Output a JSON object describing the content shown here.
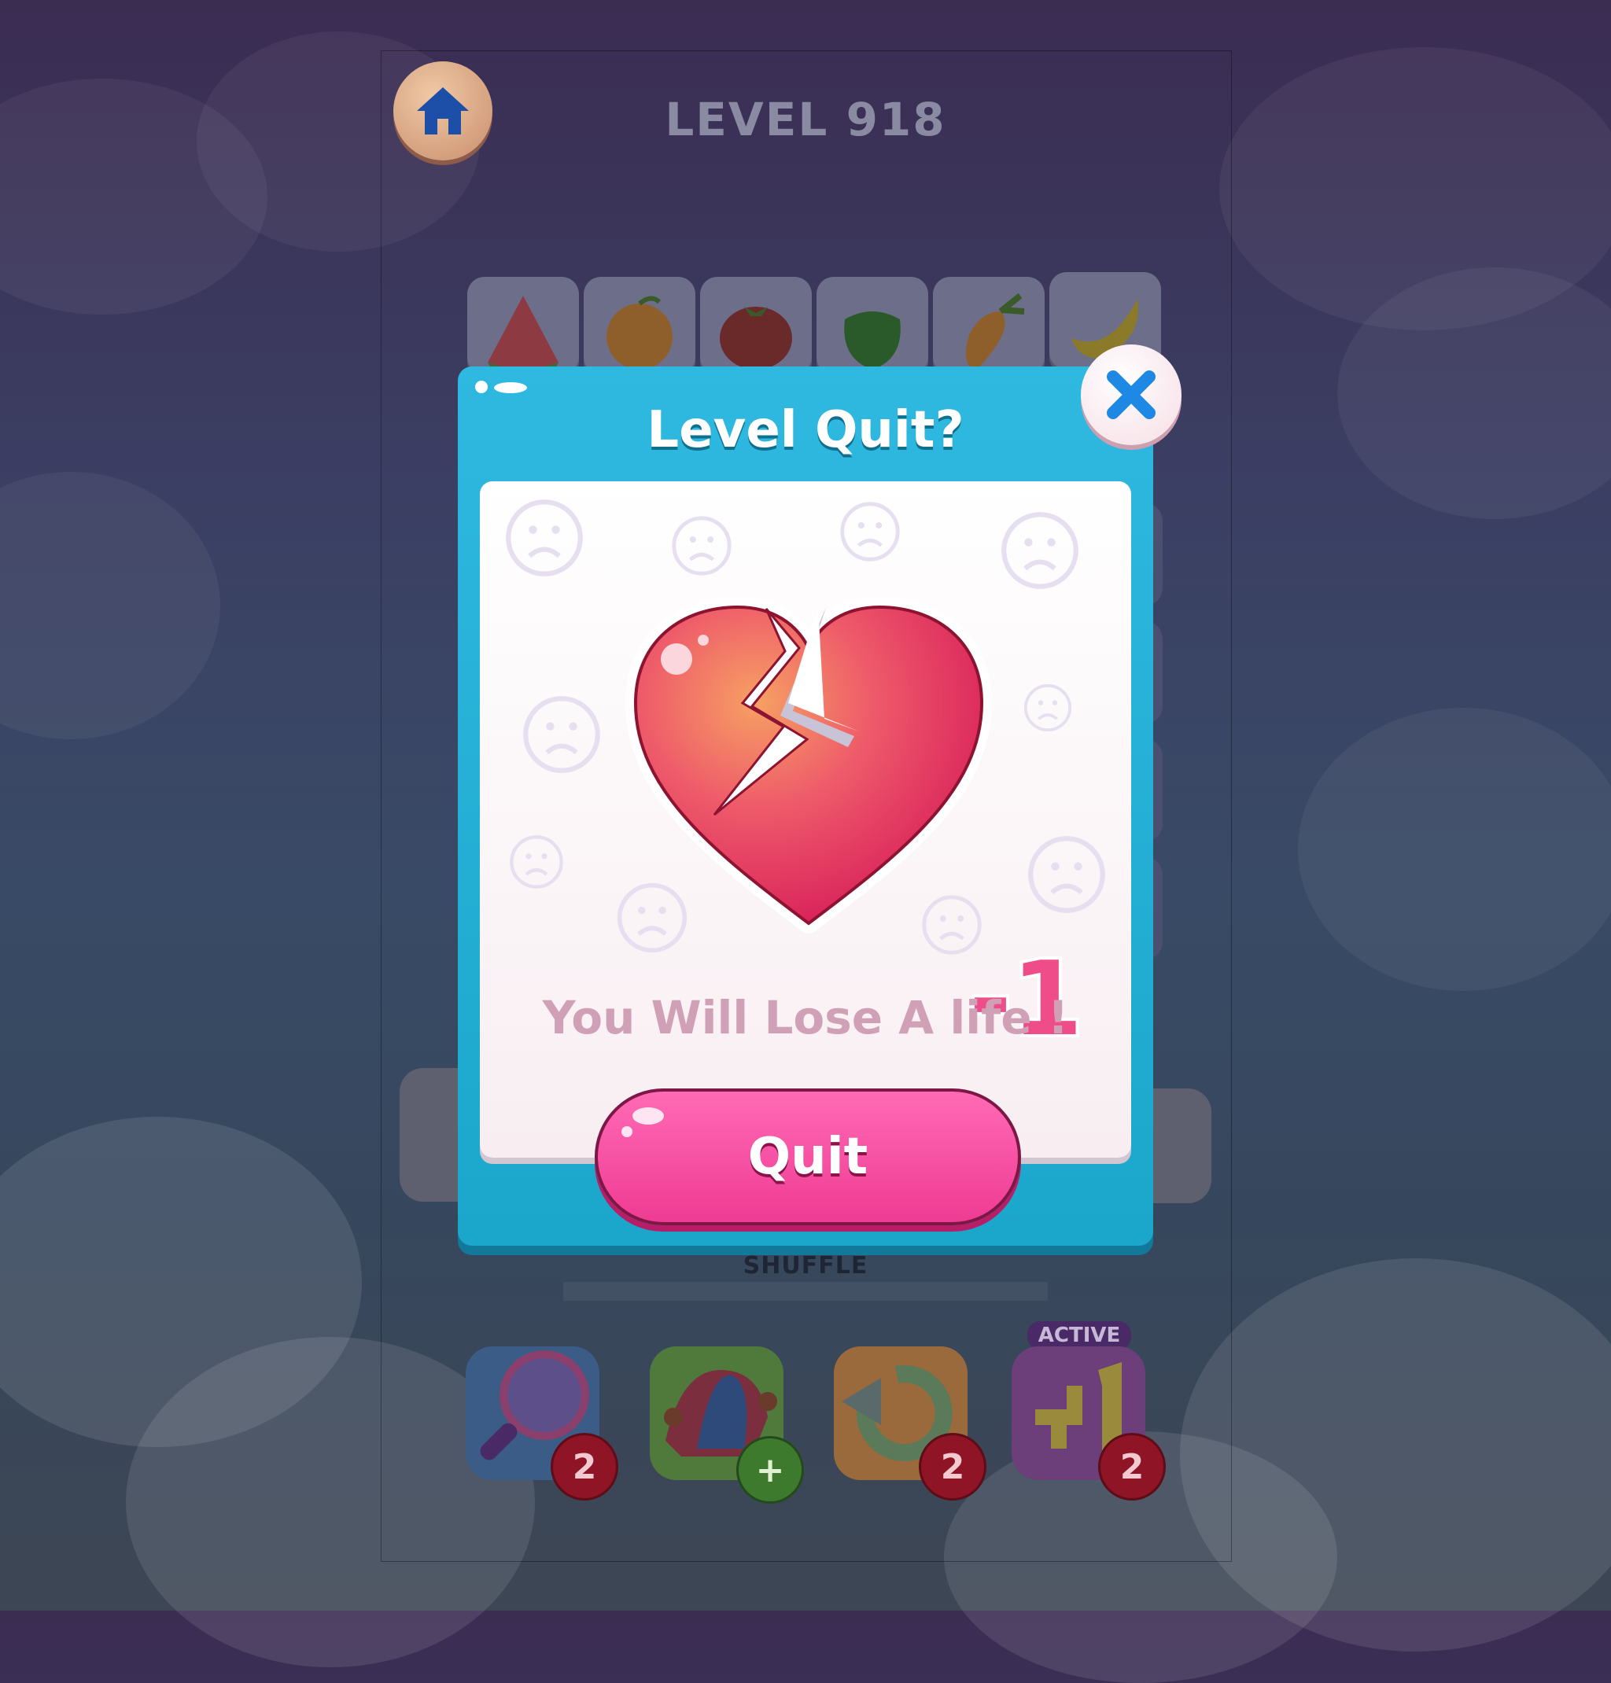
{
  "game": {
    "level_title": "LEVEL 918",
    "home_icon": "home-icon",
    "fruit_tiles": [
      "watermelon",
      "orange",
      "tomato",
      "green-pepper",
      "carrot",
      "banana"
    ],
    "shuffle_label": "SHUFFLE",
    "boosters": [
      {
        "name": "magnifier",
        "count": "2",
        "color": "#3b5c86"
      },
      {
        "name": "joker",
        "count": "+",
        "color": "#4f7a3c"
      },
      {
        "name": "undo",
        "count": "2",
        "color": "#9a6a3c"
      },
      {
        "name": "plus-one",
        "count": "2",
        "color": "#6c3f7a",
        "tag": "ACTIVE"
      }
    ]
  },
  "modal": {
    "title": "Level Quit?",
    "penalty": "-1",
    "message": "You Will Lose A life !",
    "quit_label": "Quit",
    "colors": {
      "frame": "#1ba6cb",
      "button": "#ef3b93",
      "heart": "#e23355"
    }
  }
}
